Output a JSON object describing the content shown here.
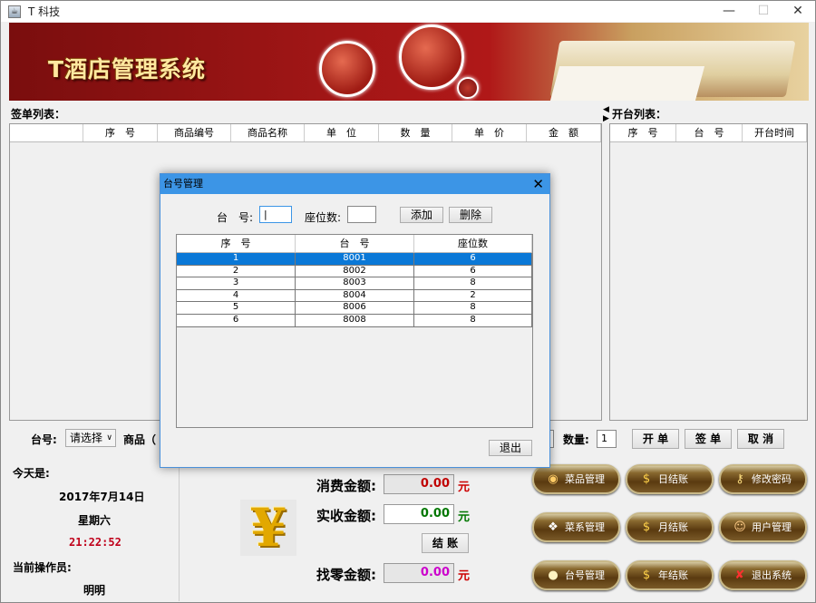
{
  "window": {
    "title": "T 科技",
    "icon": "coffee-app-icon",
    "controls": [
      "—",
      "☐",
      "✕"
    ]
  },
  "banner": {
    "title": "T酒店管理系统"
  },
  "order_list": {
    "label": "签单列表：",
    "columns": [
      "",
      "序　号",
      "商品编号",
      "商品名称",
      "单　位",
      "数　量",
      "单　价",
      "金　额"
    ]
  },
  "table_list": {
    "label": "开台列表：",
    "columns": [
      "序　号",
      "台　号",
      "开台时间"
    ]
  },
  "controls": {
    "table_label": "台号:",
    "table_select": "请选择",
    "goods_label": "商品（",
    "qty_label": "数量:",
    "qty_value": "1",
    "open_button": "开 单",
    "sign_button": "签 单",
    "cancel_button": "取 消"
  },
  "info": {
    "today_label": "今天是:",
    "date": "2017年7月14日",
    "weekday": "星期六",
    "time": "21:22:52",
    "operator_label": "当前操作员:",
    "operator": "明明",
    "time_color": "#c0001a"
  },
  "money": {
    "consume_label": "消费金额:",
    "consume_value": "0.00",
    "received_label": "实收金额:",
    "received_value": "0.00",
    "checkout_button": "结 账",
    "change_label": "找零金额:",
    "change_value": "0.00",
    "unit": "元",
    "consume_color": "#c00000",
    "received_color": "#007700",
    "change_color": "#cc00cc"
  },
  "functions": [
    {
      "label": "菜品管理",
      "icon": "dish-icon"
    },
    {
      "label": "日结账",
      "icon": "daily-ledger-icon"
    },
    {
      "label": "修改密码",
      "icon": "key-icon"
    },
    {
      "label": "菜系管理",
      "icon": "cuisine-icon"
    },
    {
      "label": "月结账",
      "icon": "monthly-ledger-icon"
    },
    {
      "label": "用户管理",
      "icon": "users-icon"
    },
    {
      "label": "台号管理",
      "icon": "table-pin-icon"
    },
    {
      "label": "年结账",
      "icon": "yearly-ledger-icon"
    },
    {
      "label": "退出系统",
      "icon": "exit-icon"
    }
  ],
  "dialog": {
    "title": "台号管理",
    "table_no_label": "台　号:",
    "seats_label": "座位数:",
    "add_button": "添加",
    "delete_button": "删除",
    "exit_button": "退出",
    "columns": [
      "序　号",
      "台　号",
      "座位数"
    ],
    "rows": [
      [
        "1",
        "8001",
        "6"
      ],
      [
        "2",
        "8002",
        "6"
      ],
      [
        "3",
        "8003",
        "8"
      ],
      [
        "4",
        "8004",
        "2"
      ],
      [
        "5",
        "8006",
        "8"
      ],
      [
        "6",
        "8008",
        "8"
      ]
    ],
    "selected_row": 0
  }
}
